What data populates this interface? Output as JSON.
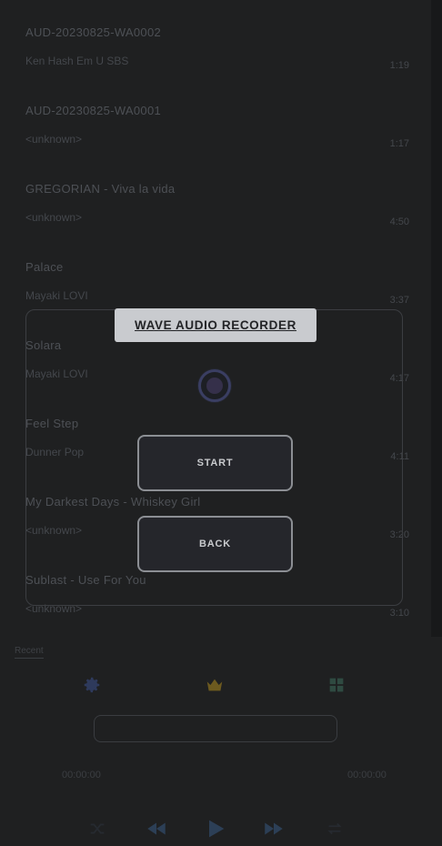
{
  "tracks": [
    {
      "title": "AUD-20230825-WA0002",
      "artist": "Ken Hash Em U SBS",
      "duration": "1:19"
    },
    {
      "title": "AUD-20230825-WA0001",
      "artist": "<unknown>",
      "duration": "1:17"
    },
    {
      "title": "GREGORIAN - Viva la vida",
      "artist": "<unknown>",
      "duration": "4:50"
    },
    {
      "title": "Palace",
      "artist": "Mayaki LOVI",
      "duration": "3:37"
    },
    {
      "title": "Solara",
      "artist": "Mayaki LOVI",
      "duration": "4:17"
    },
    {
      "title": "Feel Step",
      "artist": "Dunner Pop",
      "duration": "4:11"
    },
    {
      "title": "My Darkest Days - Whiskey Girl",
      "artist": "<unknown>",
      "duration": "3:20"
    },
    {
      "title": "Sublast - Use For You",
      "artist": "<unknown>",
      "duration": "3:10"
    }
  ],
  "mini_label": "Recent",
  "player": {
    "elapsed": "00:00:00",
    "total": "00:00:00"
  },
  "dialog": {
    "title": "WAVE AUDIO RECORDER",
    "start_label": "START",
    "back_label": "BACK"
  },
  "colors": {
    "background": "#1f2021",
    "dialog_header_bg": "#c9cbcf",
    "button_border": "#8c8f94",
    "record_ring": "#3a3e62",
    "crown_icon": "#6d5a1f",
    "settings_icon": "#2e3a5c",
    "grid_icon": "#2f4a41",
    "play_controls": "#2c3f56"
  },
  "icons": [
    "settings-icon",
    "crown-icon",
    "grid-icon",
    "shuffle-icon",
    "previous-icon",
    "play-icon",
    "next-icon",
    "repeat-icon",
    "record-indicator-icon"
  ]
}
